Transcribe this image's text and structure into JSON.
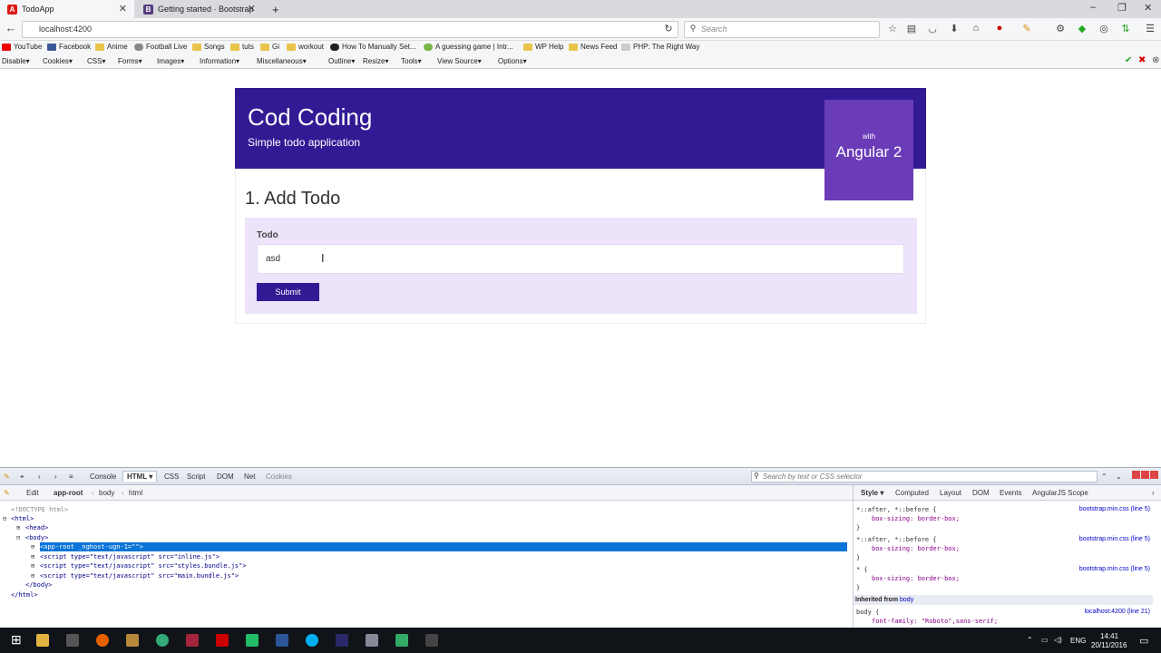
{
  "browser": {
    "tabs": [
      {
        "label": "TodoApp",
        "active": true,
        "icon": "angular-icon"
      },
      {
        "label": "Getting started · Bootstrap",
        "active": false,
        "icon": "bootstrap-icon"
      }
    ],
    "new_tab": "+",
    "url": "localhost:4200",
    "search_placeholder": "Search",
    "bookmarks": [
      "YouTube",
      "Facebook",
      "Anime",
      "Football Live",
      "Songs",
      "tuts",
      "Gi",
      "workout",
      "How To Manually Set...",
      "A guessing game | Intr...",
      "WP Help",
      "News Feed",
      "PHP: The Right Way"
    ],
    "dev_toolbar": [
      "Disable▾",
      "Cookies▾",
      "CSS▾",
      "Forms▾",
      "Images▾",
      "Information▾",
      "Miscellaneous▾",
      "Outline▾",
      "Resize▾",
      "Tools▾",
      "View Source▾",
      "Options▾"
    ]
  },
  "app": {
    "title": "Cod Coding",
    "subtitle": "Simple todo application",
    "badge_with": "with",
    "badge_name": "Angular 2",
    "section_title": "1. Add Todo",
    "todo_label": "Todo",
    "todo_value": "asd",
    "submit_label": "Submit"
  },
  "firebug": {
    "tabs": [
      "Console",
      "HTML ▾",
      "CSS",
      "Script",
      "DOM",
      "Net",
      "Cookies"
    ],
    "search_placeholder": "Search by text or CSS selector",
    "breadcrumb": [
      "Edit",
      "app-root",
      "body",
      "html"
    ],
    "html_lines": [
      "<!DOCTYPE html>",
      "<html>",
      "<head>",
      "<body>",
      "<app-root _nghost-ugn-1=\"\">",
      "<script type=\"text/javascript\" src=\"inline.js\">",
      "<script type=\"text/javascript\" src=\"styles.bundle.js\">",
      "<script type=\"text/javascript\" src=\"main.bundle.js\">",
      "</body>",
      "</html>"
    ],
    "side_tabs": [
      "Style ▾",
      "Computed",
      "Layout",
      "DOM",
      "Events",
      "AngularJS Scope"
    ],
    "css_rules": [
      {
        "selector": "*::after, *::before {",
        "prop": "box-sizing: border-box;",
        "source": "bootstrap.min.css (line 5)"
      },
      {
        "selector": "*::after, *::before {",
        "prop": "box-sizing: border-box;",
        "source": "bootstrap.min.css (line 5)"
      },
      {
        "selector": "* {",
        "prop": "box-sizing: border-box;",
        "source": "bootstrap.min.css (line 5)"
      }
    ],
    "inherited_label": "Inherited from",
    "inherited_from": "body",
    "body_rule": {
      "selector": "body {",
      "prop": "font-family: \"Roboto\",sans-serif;",
      "source": "localhost:4200 (line 21)"
    }
  },
  "taskbar": {
    "lang": "ENG",
    "time": "14:41",
    "date": "20/11/2016"
  },
  "colors": {
    "brand": "#311a94",
    "badge": "#6a3cb7",
    "form_bg": "#ede3fa",
    "selection": "#0a74d8"
  }
}
